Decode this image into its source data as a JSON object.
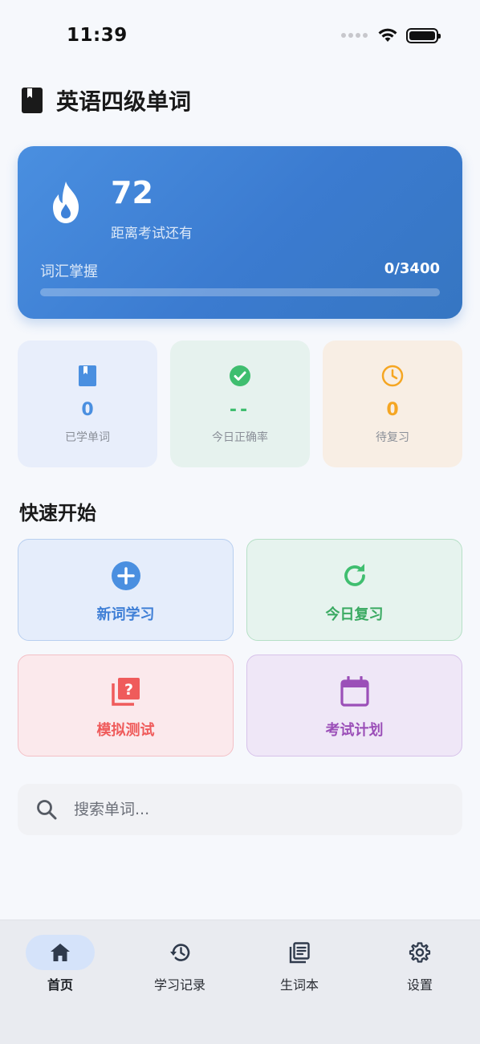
{
  "status_bar": {
    "time": "11:39"
  },
  "header": {
    "title": "英语四级单词"
  },
  "hero": {
    "days_left": "72",
    "caption": "距离考试还有",
    "vocab_label": "词汇掌握",
    "vocab_count": "0/3400",
    "mastered_fraction": 0
  },
  "stats": [
    {
      "value": "0",
      "label": "已学单词",
      "icon": "book-icon",
      "color": "#4a8fe0"
    },
    {
      "value": "--",
      "label": "今日正确率",
      "icon": "check-circle-icon",
      "color": "#3fbe6f"
    },
    {
      "value": "0",
      "label": "待复习",
      "icon": "clock-icon",
      "color": "#f5a623"
    }
  ],
  "quick_start": {
    "title": "快速开始",
    "items": [
      {
        "label": "新词学习",
        "icon": "plus-circle-icon",
        "color": "#3f7fd6"
      },
      {
        "label": "今日复习",
        "icon": "refresh-icon",
        "color": "#3aaa62"
      },
      {
        "label": "模拟测试",
        "icon": "quiz-icon",
        "color": "#ef5b5b"
      },
      {
        "label": "考试计划",
        "icon": "calendar-icon",
        "color": "#9b4fb8"
      }
    ]
  },
  "search": {
    "placeholder": "搜索单词..."
  },
  "tab_bar": {
    "tabs": [
      {
        "label": "首页",
        "icon": "home-icon",
        "active": true
      },
      {
        "label": "学习记录",
        "icon": "history-icon",
        "active": false
      },
      {
        "label": "生词本",
        "icon": "notebook-icon",
        "active": false
      },
      {
        "label": "设置",
        "icon": "gear-icon",
        "active": false
      }
    ]
  }
}
